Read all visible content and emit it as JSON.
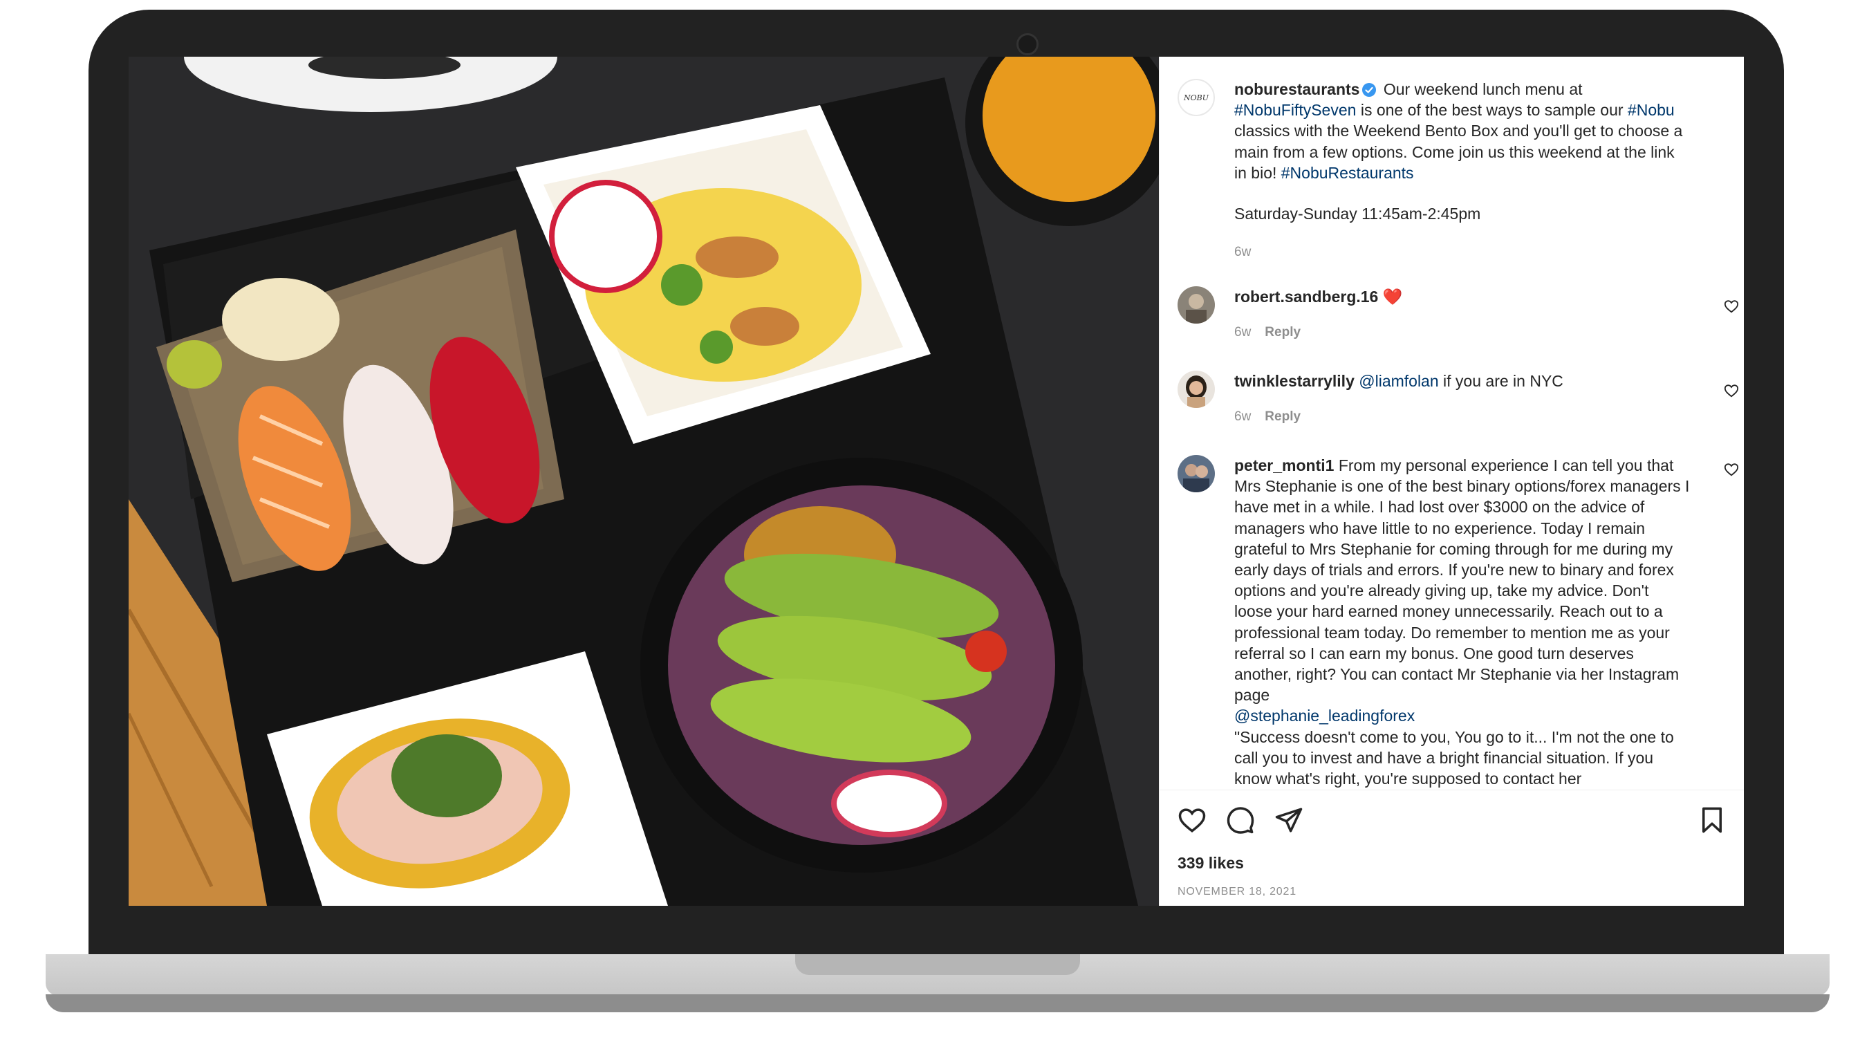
{
  "post": {
    "brand_logo_text": "NOBU",
    "author": "noburestaurants",
    "caption_intro": " Our weekend lunch menu at ",
    "tag_fiftyseven": "#NobuFiftySeven",
    "caption_mid": " is one of the best ways to sample our ",
    "tag_nobu": "#Nobu",
    "caption_rest": " classics with the Weekend Bento Box and you'll get to choose a main from a few options. Come join us this weekend at the link in bio! ",
    "tag_restaurants": "#NobuRestaurants",
    "hours": "Saturday-Sunday 11:45am-2:45pm",
    "age": "6w",
    "likes": "339 likes",
    "date": "NOVEMBER 18, 2021"
  },
  "comments": [
    {
      "user": "robert.sandberg.16",
      "text": " ❤️",
      "age": "6w",
      "reply": "Reply"
    },
    {
      "user": "twinklestarrylily",
      "mention": "@liamfolan",
      "text": " if you are in NYC",
      "age": "6w",
      "reply": "Reply"
    },
    {
      "user": "peter_monti1",
      "text": " From my personal experience I can tell you that Mrs Stephanie is one of the best binary options/forex managers I have met in a while. I had lost over $3000 on the advice of managers who have little to no experience. Today I remain grateful to Mrs Stephanie for coming through for me during my early days of trials and errors. If you're new to binary and forex options and you're already giving up, take my advice. Don't loose your hard earned money unnecessarily. Reach out to a professional team today. Do remember to mention me as your referral so I can earn my bonus. One good turn deserves another, right? You can contact Mr Stephanie via her Instagram page\n",
      "mention": "@stephanie_leadingforex",
      "text_after": "\n\"Success doesn't come to you, You go to it... I'm not the one to call you to invest and have a bright financial situation. If you know what's right, you're supposed to contact her"
    }
  ],
  "icons": {
    "like": "heart-icon",
    "comment": "comment-icon",
    "share": "paper-plane-icon",
    "save": "bookmark-icon",
    "comment_like": "heart-icon",
    "verified": "verified-badge-icon"
  },
  "colors": {
    "link": "#00376b",
    "verified": "#3897f0",
    "muted": "#8e8e8e"
  }
}
